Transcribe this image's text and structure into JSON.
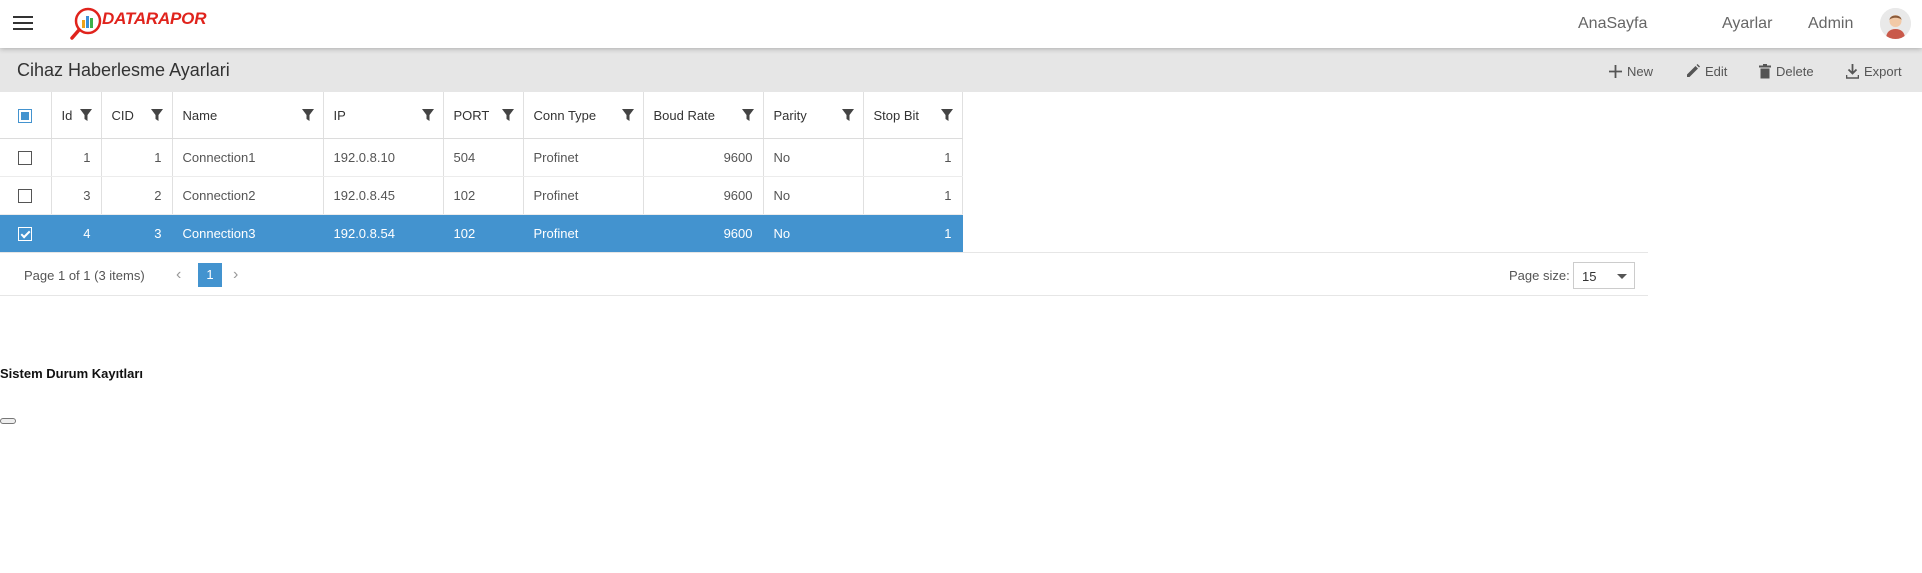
{
  "navbar": {
    "logo_text": "DATARAPOR",
    "links": {
      "home": "AnaSayfa",
      "settings": "Ayarlar",
      "user": "Admin"
    }
  },
  "toolbar": {
    "title": "Cihaz Haberlesme Ayarlari",
    "new_label": "New",
    "edit_label": "Edit",
    "delete_label": "Delete",
    "export_label": "Export"
  },
  "grid": {
    "columns": {
      "id": "Id",
      "cid": "CID",
      "name": "Name",
      "ip": "IP",
      "port": "PORT",
      "conn_type": "Conn Type",
      "boud_rate": "Boud Rate",
      "parity": "Parity",
      "stop_bit": "Stop Bit"
    },
    "rows": [
      {
        "selected": false,
        "id": "1",
        "cid": "1",
        "name": "Connection1",
        "ip": "192.0.8.10",
        "port": "504",
        "conn_type": "Profinet",
        "boud_rate": "9600",
        "parity": "No",
        "stop_bit": "1"
      },
      {
        "selected": false,
        "id": "3",
        "cid": "2",
        "name": "Connection2",
        "ip": "192.0.8.45",
        "port": "102",
        "conn_type": "Profinet",
        "boud_rate": "9600",
        "parity": "No",
        "stop_bit": "1"
      },
      {
        "selected": true,
        "id": "4",
        "cid": "3",
        "name": "Connection3",
        "ip": "192.0.8.54",
        "port": "102",
        "conn_type": "Profinet",
        "boud_rate": "9600",
        "parity": "No",
        "stop_bit": "1"
      }
    ]
  },
  "pager": {
    "summary": "Page 1 of 1 (3 items)",
    "current_page": "1",
    "page_size_label": "Page size:",
    "page_size_value": "15"
  },
  "section": {
    "title": "Sistem Durum Kayıtları"
  },
  "colors": {
    "accent": "#4393cf",
    "logo": "#e0231c",
    "toolbar_bg": "#e6e6e6"
  }
}
